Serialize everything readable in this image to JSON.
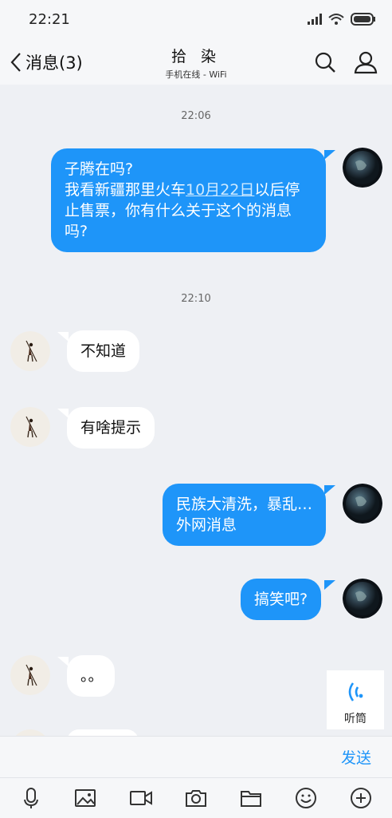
{
  "status_bar": {
    "time": "22:21"
  },
  "header": {
    "back_label": "消息(3)",
    "contact_name": "拾 染",
    "contact_status": "手机在线 - WiFi"
  },
  "messages": [
    {
      "type": "timestamp",
      "text": "22:06"
    },
    {
      "type": "outgoing",
      "lines": [
        "子腾在吗?",
        "我看新疆那里火车",
        "以后停",
        "止售票，你有什么关于这个的消息",
        "吗?"
      ],
      "link_text": "10月22日"
    },
    {
      "type": "timestamp",
      "text": "22:10"
    },
    {
      "type": "incoming",
      "text": "不知道"
    },
    {
      "type": "incoming",
      "text": "有啥提示"
    },
    {
      "type": "outgoing",
      "lines": [
        "民族大清洗，暴乱…",
        "外网消息"
      ]
    },
    {
      "type": "outgoing",
      "text": "搞笑吧?"
    },
    {
      "type": "incoming",
      "text": "。。"
    }
  ],
  "earpiece": {
    "label": "听筒"
  },
  "input": {
    "send_label": "发送"
  },
  "toolbar": [
    "mic-icon",
    "image-icon",
    "video-icon",
    "camera-icon",
    "folder-icon",
    "emoji-icon",
    "plus-icon"
  ],
  "colors": {
    "accent": "#1e95f9",
    "background": "#eef0f4"
  }
}
